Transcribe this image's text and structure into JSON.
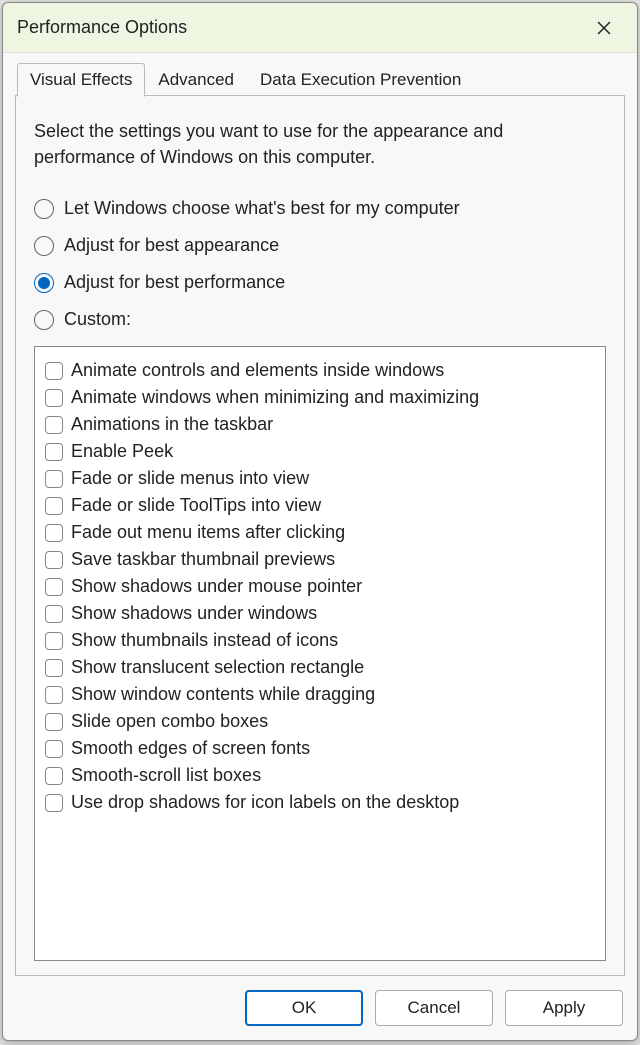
{
  "title": "Performance Options",
  "tabs": [
    {
      "label": "Visual Effects",
      "active": true
    },
    {
      "label": "Advanced",
      "active": false
    },
    {
      "label": "Data Execution Prevention",
      "active": false
    }
  ],
  "description": "Select the settings you want to use for the appearance and performance of Windows on this computer.",
  "radios": [
    {
      "label": "Let Windows choose what's best for my computer",
      "checked": false
    },
    {
      "label": "Adjust for best appearance",
      "checked": false
    },
    {
      "label": "Adjust for best performance",
      "checked": true
    },
    {
      "label": "Custom:",
      "checked": false
    }
  ],
  "checkboxes": [
    {
      "label": "Animate controls and elements inside windows",
      "checked": false
    },
    {
      "label": "Animate windows when minimizing and maximizing",
      "checked": false
    },
    {
      "label": "Animations in the taskbar",
      "checked": false
    },
    {
      "label": "Enable Peek",
      "checked": false
    },
    {
      "label": "Fade or slide menus into view",
      "checked": false
    },
    {
      "label": "Fade or slide ToolTips into view",
      "checked": false
    },
    {
      "label": "Fade out menu items after clicking",
      "checked": false
    },
    {
      "label": "Save taskbar thumbnail previews",
      "checked": false
    },
    {
      "label": "Show shadows under mouse pointer",
      "checked": false
    },
    {
      "label": "Show shadows under windows",
      "checked": false
    },
    {
      "label": "Show thumbnails instead of icons",
      "checked": false
    },
    {
      "label": "Show translucent selection rectangle",
      "checked": false
    },
    {
      "label": "Show window contents while dragging",
      "checked": false
    },
    {
      "label": "Slide open combo boxes",
      "checked": false
    },
    {
      "label": "Smooth edges of screen fonts",
      "checked": false
    },
    {
      "label": "Smooth-scroll list boxes",
      "checked": false
    },
    {
      "label": "Use drop shadows for icon labels on the desktop",
      "checked": false
    }
  ],
  "buttons": {
    "ok": "OK",
    "cancel": "Cancel",
    "apply": "Apply"
  }
}
